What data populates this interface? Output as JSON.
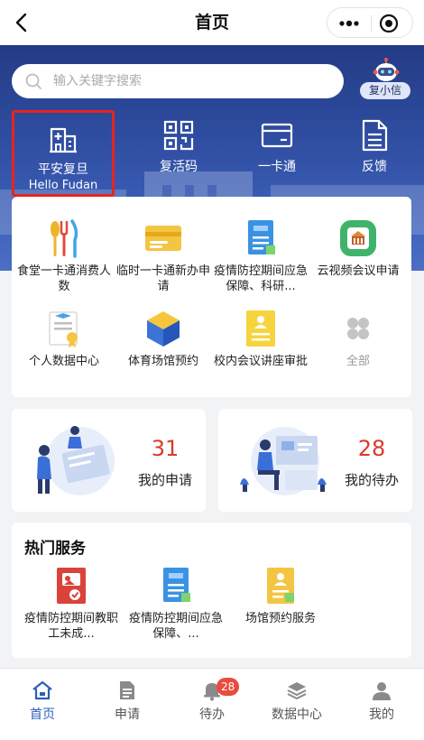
{
  "navbar": {
    "title": "首页"
  },
  "search": {
    "placeholder": "输入关键字搜索"
  },
  "assistant": {
    "label": "复小信"
  },
  "quick_actions": [
    {
      "label": "平安复旦",
      "sub": "Hello Fudan",
      "icon": "hospital-building-icon",
      "highlighted": true
    },
    {
      "label": "复活码",
      "icon": "qr-code-icon"
    },
    {
      "label": "一卡通",
      "icon": "card-icon"
    },
    {
      "label": "反馈",
      "icon": "document-icon"
    }
  ],
  "services": [
    {
      "label": "食堂一卡通消费人数",
      "icon": "cutlery-icon"
    },
    {
      "label": "临时一卡通新办申请",
      "icon": "temp-card-icon"
    },
    {
      "label": "疫情防控期间应急保障、科研...",
      "icon": "epidemic-doc-icon"
    },
    {
      "label": "云视频会议申请",
      "icon": "video-meeting-icon"
    },
    {
      "label": "个人数据中心",
      "icon": "certificate-icon"
    },
    {
      "label": "体育场馆预约",
      "icon": "stadium-cube-icon"
    },
    {
      "label": "校内会议讲座审批",
      "icon": "meeting-approval-icon"
    },
    {
      "label": "全部",
      "icon": "all-grid-icon"
    }
  ],
  "stats": {
    "applications": {
      "count": "31",
      "label": "我的申请"
    },
    "todos": {
      "count": "28",
      "label": "我的待办"
    }
  },
  "hot": {
    "title": "热门服务",
    "items": [
      {
        "label": "疫情防控期间教职工未成...",
        "icon": "red-report-icon"
      },
      {
        "label": "疫情防控期间应急保障、...",
        "icon": "epidemic-doc-icon"
      },
      {
        "label": "场馆预约服务",
        "icon": "venue-doc-icon"
      }
    ]
  },
  "tabbar": {
    "items": [
      {
        "label": "首页",
        "icon": "home-icon",
        "active": true
      },
      {
        "label": "申请",
        "icon": "apply-doc-icon"
      },
      {
        "label": "待办",
        "icon": "bell-icon",
        "badge": "28"
      },
      {
        "label": "数据中心",
        "icon": "layers-icon"
      },
      {
        "label": "我的",
        "icon": "person-icon"
      }
    ]
  },
  "colors": {
    "primary": "#2b5fb8",
    "accent_red": "#d93a2b",
    "highlight_border": "#e8231f",
    "hero": "#2d4a9c"
  }
}
